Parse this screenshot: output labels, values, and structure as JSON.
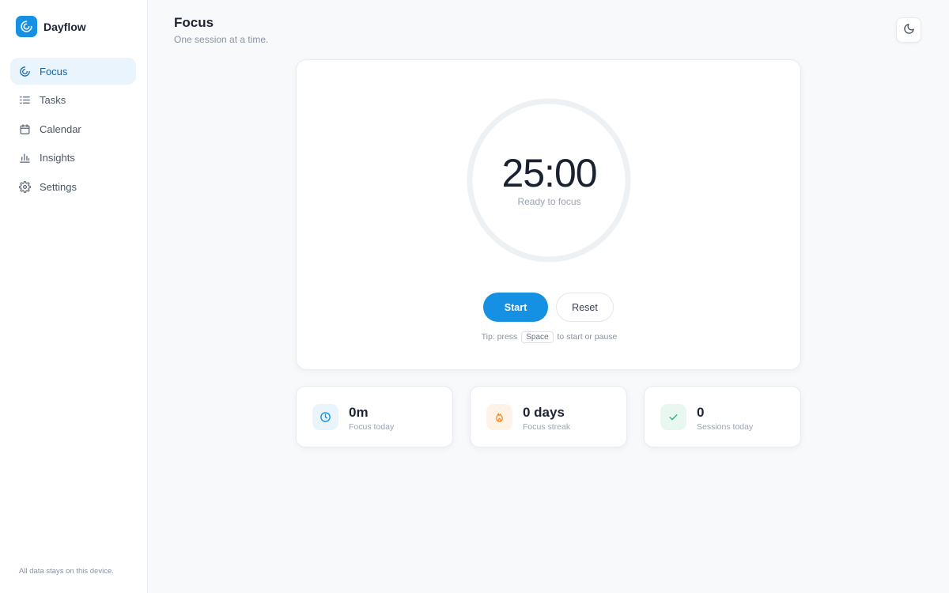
{
  "app": {
    "name": "Dayflow",
    "accent": "#1590e3"
  },
  "sidebar": {
    "items": [
      {
        "label": "Focus",
        "icon": "focus-icon",
        "active": true
      },
      {
        "label": "Tasks",
        "icon": "tasks-icon",
        "active": false
      },
      {
        "label": "Calendar",
        "icon": "calendar-icon",
        "active": false
      },
      {
        "label": "Insights",
        "icon": "bar-chart-icon",
        "active": false
      },
      {
        "label": "Settings",
        "icon": "gear-icon",
        "active": false
      }
    ],
    "footer": "All data stays on this device."
  },
  "header": {
    "title": "Focus",
    "subtitle": "One session at a time.",
    "theme_toggle_icon": "moon-icon"
  },
  "timer": {
    "time": "25:00",
    "status": "Ready to focus",
    "start_label": "Start",
    "reset_label": "Reset",
    "tip_prefix": "Tip: press",
    "tip_key": "Space",
    "tip_suffix": "to start or pause",
    "progress": 0
  },
  "stats": [
    {
      "value": "0m",
      "label": "Focus today",
      "icon": "clock-icon",
      "color": "#1590e3",
      "bg": "#eaf4fd"
    },
    {
      "value": "0 days",
      "label": "Focus streak",
      "icon": "flame-icon",
      "color": "#f08a24",
      "bg": "#fff3e6"
    },
    {
      "value": "0",
      "label": "Sessions today",
      "icon": "check-icon",
      "color": "#22b573",
      "bg": "#e8f8f0"
    }
  ]
}
